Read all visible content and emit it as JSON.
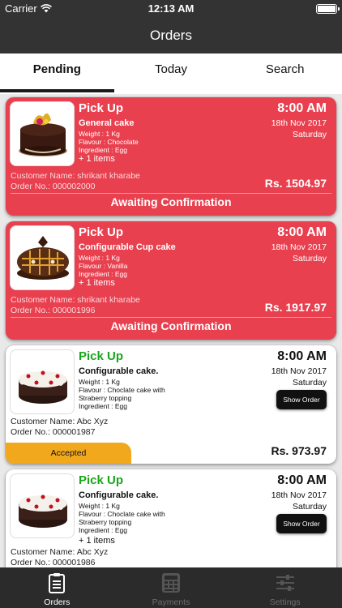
{
  "status_bar": {
    "carrier": "Carrier",
    "time": "12:13 AM"
  },
  "nav": {
    "title": "Orders"
  },
  "tabs": [
    {
      "label": "Pending",
      "active": true
    },
    {
      "label": "Today",
      "active": false
    },
    {
      "label": "Search",
      "active": false
    }
  ],
  "orders": [
    {
      "type": "Pick Up",
      "name": "General cake",
      "weight": "Weight : 1 Kg",
      "flavour": "Flavour : Chocolate",
      "ingredient": "Ingredient : Egg",
      "items": "+ 1 items",
      "time": "8:00 AM",
      "date": "18th Nov 2017",
      "day": "Saturday",
      "customer": "Customer Name: shrikant kharabe",
      "order_no": "Order No.: 000002000",
      "amount": "Rs. 1504.97",
      "status": "Awaiting Confirmation"
    },
    {
      "type": "Pick Up",
      "name": "Configurable Cup cake",
      "weight": "Weight : 1 Kg",
      "flavour": "Flavour : Vanilla",
      "ingredient": "Ingredient : Egg",
      "items": "+ 1 items",
      "time": "8:00 AM",
      "date": "18th Nov 2017",
      "day": "Saturday",
      "customer": "Customer Name: shrikant kharabe",
      "order_no": "Order No.: 000001996",
      "amount": "Rs. 1917.97",
      "status": "Awaiting Confirmation"
    },
    {
      "type": "Pick Up",
      "name": "Configurable cake.",
      "weight": "Weight : 1 Kg",
      "flavour_line1": "Flavour : Choclate cake with",
      "flavour_line2": "Straberry topping",
      "ingredient": "Ingredient : Egg",
      "time": "8:00 AM",
      "date": "18th Nov 2017",
      "day": "Saturday",
      "show_order": "Show Order",
      "customer": "Customer Name: Abc Xyz",
      "order_no": "Order No.: 000001987",
      "amount": "Rs. 973.97",
      "status": "Accepted"
    },
    {
      "type": "Pick Up",
      "name": "Configurable cake.",
      "weight": "Weight : 1 Kg",
      "flavour_line1": "Flavour : Choclate cake with",
      "flavour_line2": "Straberry topping",
      "ingredient": "Ingredient : Egg",
      "items": "+ 1 items",
      "time": "8:00 AM",
      "date": "18th Nov 2017",
      "day": "Saturday",
      "show_order": "Show Order",
      "customer": "Customer Name: Abc Xyz",
      "order_no": "Order No.: 000001986"
    }
  ],
  "tab_bar": [
    {
      "label": "Orders",
      "icon": "orders-clipboard-icon",
      "active": true
    },
    {
      "label": "Payments",
      "icon": "payments-calculator-icon",
      "active": false
    },
    {
      "label": "Settings",
      "icon": "settings-sliders-icon",
      "active": false
    }
  ],
  "colors": {
    "bar": "#333333",
    "pending_card": "#e8404f",
    "accepted_badge": "#f2a81d",
    "pickup_green": "#1aa51a"
  }
}
